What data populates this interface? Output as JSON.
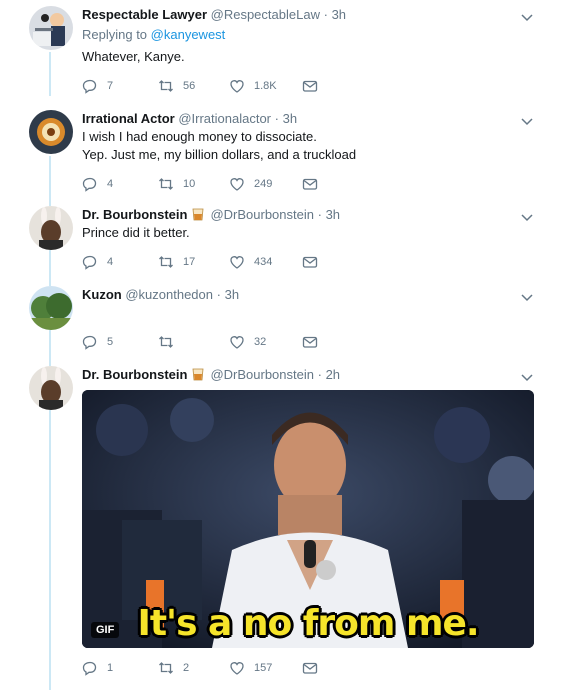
{
  "tweets": [
    {
      "name": "Respectable Lawyer",
      "handle": "@RespectableLaw",
      "time": "3h",
      "replying_label": "Replying to",
      "replying_to": "@kanyewest",
      "lines": [
        "Whatever, Kanye."
      ],
      "replies": "7",
      "retweets": "56",
      "likes": "1.8K"
    },
    {
      "name": "Irrational Actor",
      "handle": "@Irrationalactor",
      "time": "3h",
      "lines": [
        "I wish I had enough money to dissociate.",
        "Yep. Just me, my billion dollars, and a truckload"
      ],
      "replies": "4",
      "retweets": "10",
      "likes": "249"
    },
    {
      "name": "Dr. Bourbonstein",
      "handle": "@DrBourbonstein",
      "time": "3h",
      "lines": [
        "Prince did it better."
      ],
      "replies": "4",
      "retweets": "17",
      "likes": "434"
    },
    {
      "name": "Kuzon",
      "handle": "@kuzonthedon",
      "time": "3h",
      "lines": [],
      "replies": "5",
      "retweets": "",
      "likes": "32"
    },
    {
      "name": "Dr. Bourbonstein",
      "handle": "@DrBourbonstein",
      "time": "2h",
      "lines": [],
      "media": {
        "badge": "GIF",
        "caption": "It's a no from me."
      },
      "replies": "1",
      "retweets": "2",
      "likes": "157"
    }
  ],
  "dot": "·",
  "icons": {
    "reply": "reply-icon",
    "retweet": "retweet-icon",
    "like": "heart-icon",
    "dm": "envelope-icon",
    "caret": "chevron-down-icon"
  },
  "colors": {
    "link": "#1b95e0",
    "muted": "#657786",
    "thread": "#cce8f5",
    "caption": "#f6e42a"
  }
}
